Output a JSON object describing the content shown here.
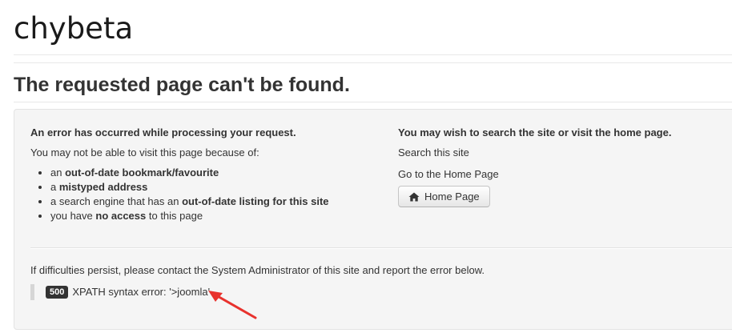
{
  "site": {
    "title": "chybeta"
  },
  "page": {
    "heading": "The requested page can't be found."
  },
  "left": {
    "heading": "An error has occurred while processing your request.",
    "intro": "You may not be able to visit this page because of:",
    "reasons": [
      {
        "pre": "an ",
        "bold": "out-of-date bookmark/favourite",
        "post": ""
      },
      {
        "pre": "a ",
        "bold": "mistyped address",
        "post": ""
      },
      {
        "pre": "a search engine that has an ",
        "bold": "out-of-date listing for this site",
        "post": ""
      },
      {
        "pre": "you have ",
        "bold": "no access",
        "post": " to this page"
      }
    ]
  },
  "right": {
    "heading": "You may wish to search the site or visit the home page.",
    "search_link": "Search this site",
    "home_link": "Go to the Home Page",
    "home_button_label": "Home Page",
    "home_button_icon": "home-icon"
  },
  "footer": {
    "persist_text": "If difficulties persist, please contact the System Administrator of this site and report the error below.",
    "error_code": "500",
    "error_message": "XPATH syntax error: '>joomla'"
  },
  "colors": {
    "badge_bg": "#333333",
    "well_bg": "#f5f5f5",
    "annotation_arrow": "#e8322d"
  }
}
